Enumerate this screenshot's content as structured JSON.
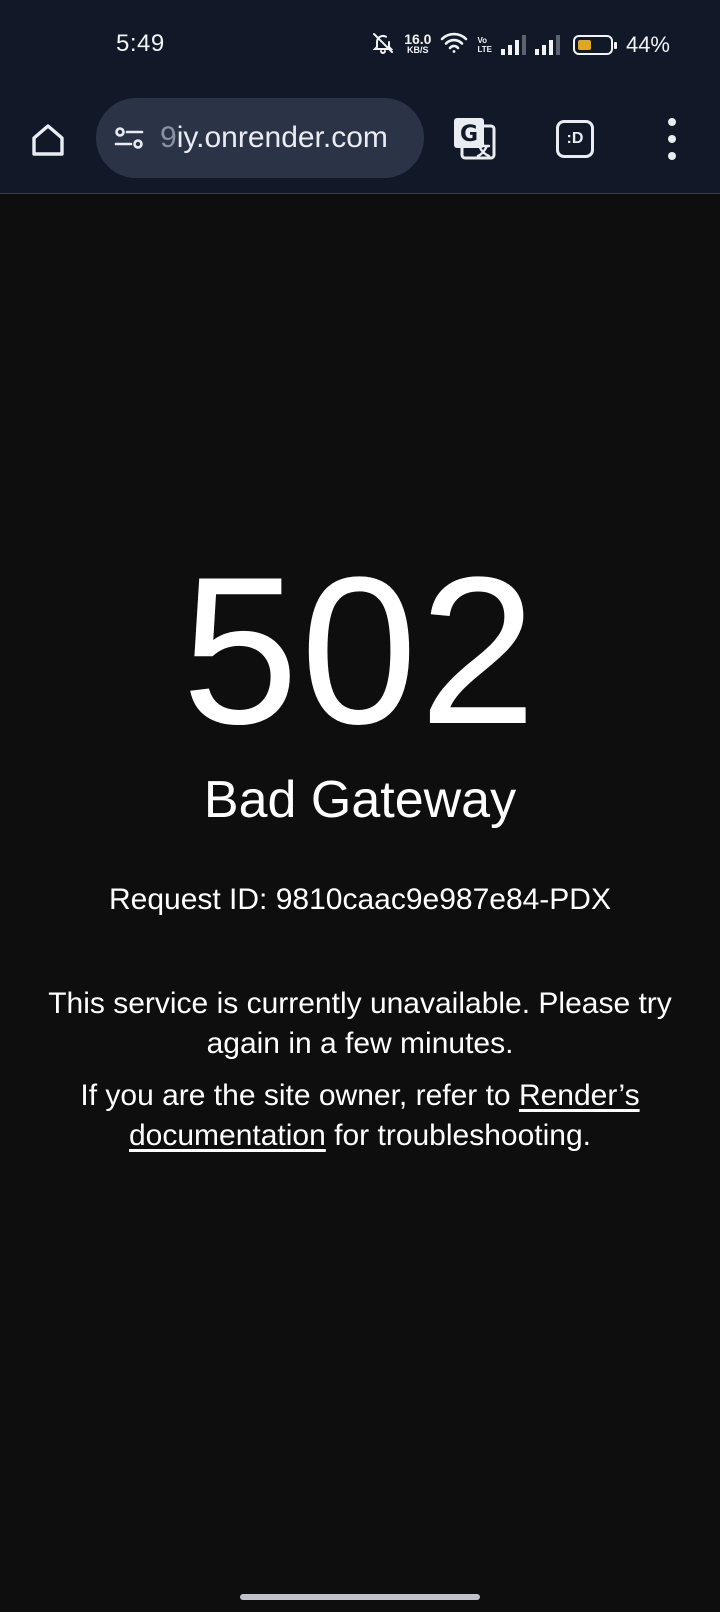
{
  "status_bar": {
    "time": "5:49",
    "net_speed_value": "16.0",
    "net_speed_unit": "KB/S",
    "volte_top": "Vo",
    "volte_bottom": "LTE",
    "battery_percent": "44%",
    "battery_level": 0.44,
    "battery_color": "#e0a820"
  },
  "toolbar": {
    "url_prefix": "9",
    "url_main": "iy.onrender.com",
    "tab_label": ":D",
    "icons": [
      "home-icon",
      "site-settings-icon",
      "translate-icon",
      "tab-switcher-icon",
      "more-vert-icon"
    ]
  },
  "page": {
    "code": "502",
    "status": "Bad Gateway",
    "request_id": "Request ID: 9810caac9e987e84-PDX",
    "message": "This service is currently unavailable. Please try again in a few minutes.",
    "owner_prefix": "If you are the site owner, refer to ",
    "owner_link": "Render’s documentation",
    "owner_suffix": " for troubleshooting."
  }
}
